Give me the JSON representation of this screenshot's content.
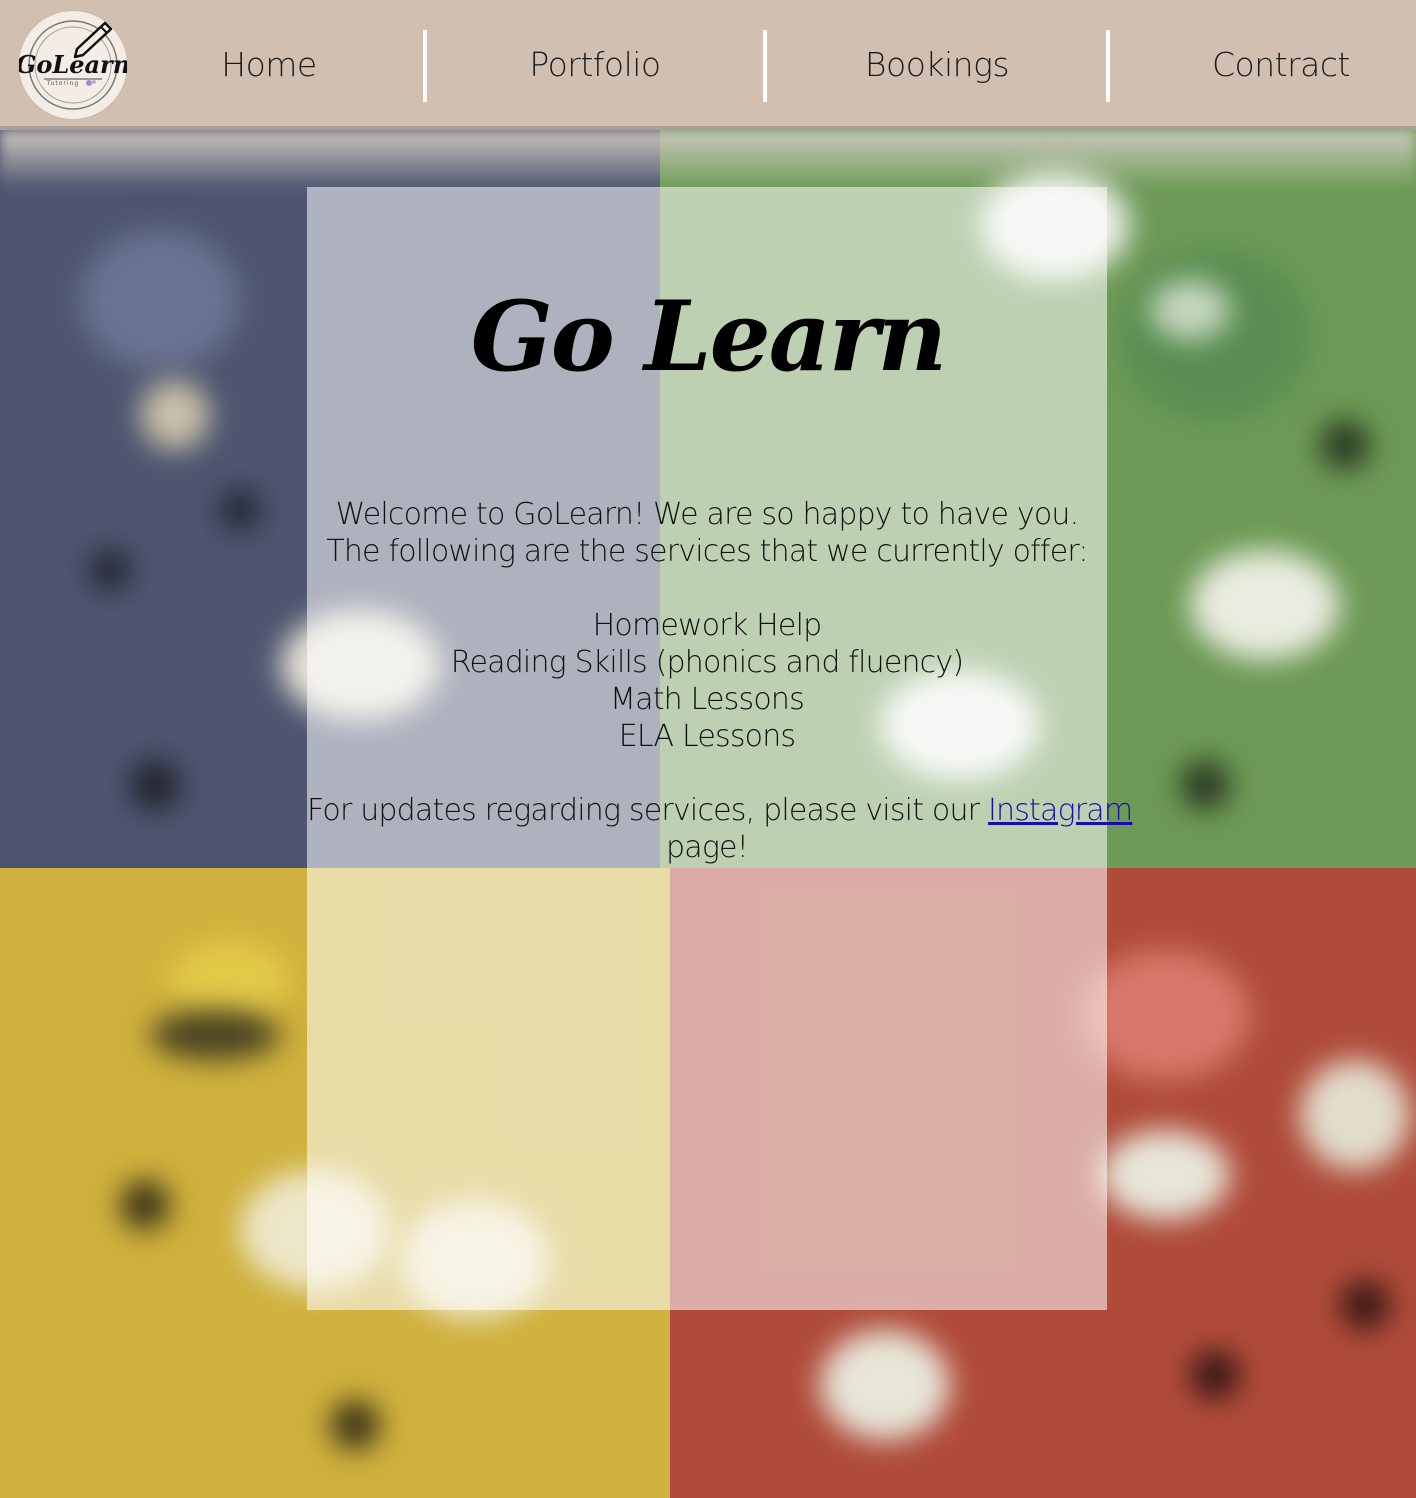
{
  "header": {
    "logo": {
      "wordmark": "GoLearn",
      "tagline": "Tutoring"
    },
    "nav": {
      "home": "Home",
      "portfolio": "Portfolio",
      "bookings": "Bookings",
      "contract": "Contract"
    }
  },
  "main": {
    "title": "Go Learn",
    "welcome_line1": "Welcome to GoLearn! We are so happy to have you.",
    "welcome_line2": "The following are the services that we currently offer:",
    "services": [
      "Homework Help",
      "Reading Skills (phonics and fluency)",
      "Math Lessons",
      "ELA Lessons"
    ],
    "updates_prefix": "For updates regarding services, please visit our ",
    "instagram_link": "Instagram",
    "updates_suffix": "page!"
  },
  "colors": {
    "header_bg": "#d1bfb2",
    "link": "#1a0dab",
    "quad_blue": "#4d5570",
    "quad_green": "#6d9a56",
    "quad_yellow": "#cfb13d",
    "quad_red": "#b04b3a"
  },
  "icons": {
    "logo_pencil": "pencil-icon"
  }
}
